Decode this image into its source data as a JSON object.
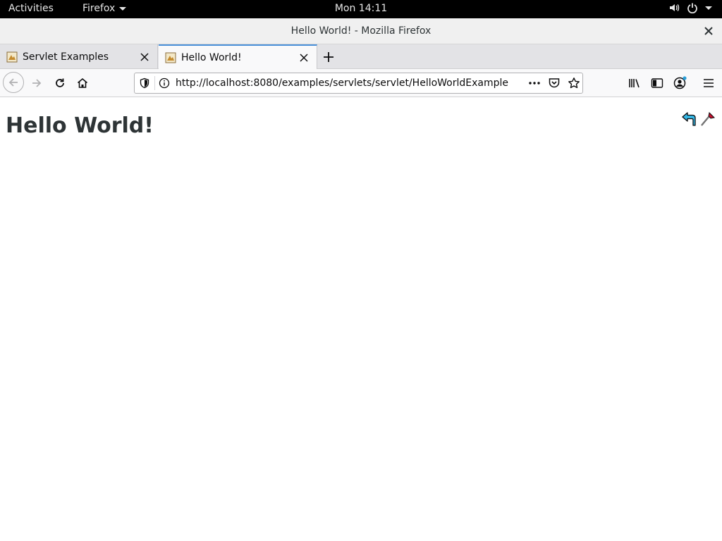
{
  "topbar": {
    "activities": "Activities",
    "app_menu": "Firefox",
    "clock": "Mon 14:11"
  },
  "window": {
    "title": "Hello World! - Mozilla Firefox"
  },
  "tabs": [
    {
      "label": "Servlet Examples",
      "active": false
    },
    {
      "label": "Hello World!",
      "active": true
    }
  ],
  "navbar": {
    "url": "http://localhost:8080/examples/servlets/servlet/HelloWorldExample"
  },
  "page": {
    "heading": "Hello World!"
  },
  "colors": {
    "accent": "#4a90d9",
    "heading": "#2e3436"
  }
}
